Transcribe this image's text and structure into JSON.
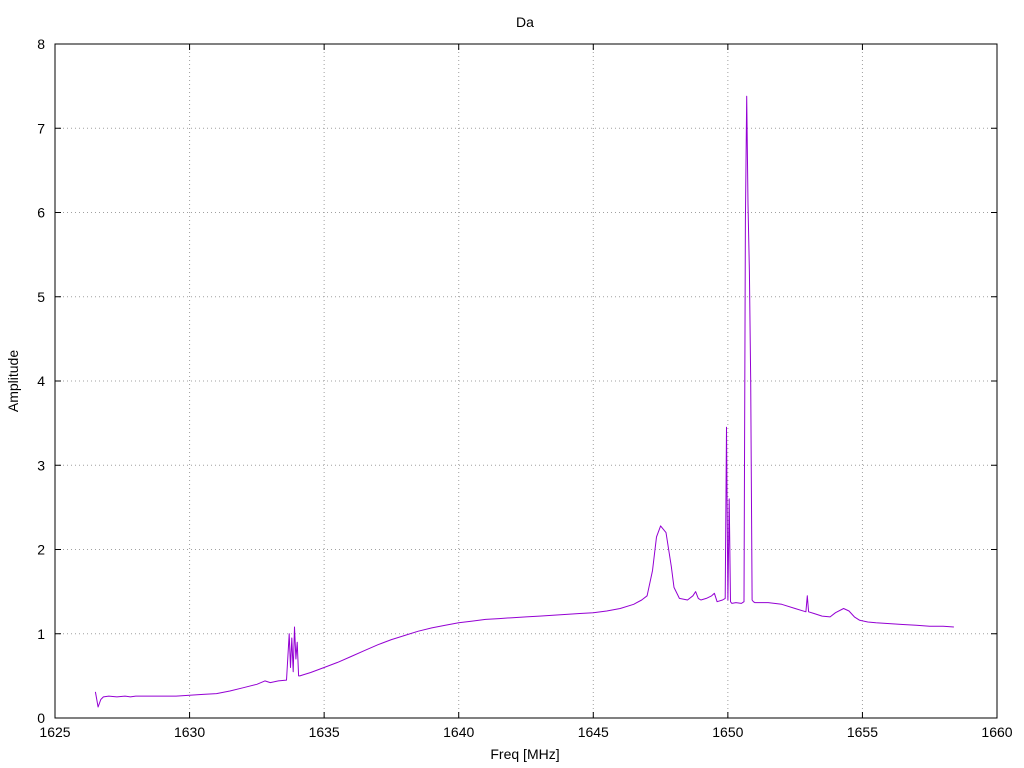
{
  "chart_data": {
    "type": "line",
    "title": "Da",
    "xlabel": "Freq [MHz]",
    "ylabel": "Amplitude",
    "xlim": [
      1625,
      1660
    ],
    "ylim": [
      0,
      8
    ],
    "xticks": [
      1625,
      1630,
      1635,
      1640,
      1645,
      1650,
      1655,
      1660
    ],
    "yticks": [
      0,
      1,
      2,
      3,
      4,
      5,
      6,
      7,
      8
    ],
    "grid": true,
    "legend": "none",
    "series": [
      {
        "color": "#9400d3",
        "x": [
          1626.5,
          1626.6,
          1626.7,
          1626.8,
          1627.0,
          1627.3,
          1627.6,
          1627.8,
          1628.0,
          1628.5,
          1629.0,
          1629.5,
          1630.0,
          1630.5,
          1631.0,
          1631.5,
          1632.0,
          1632.5,
          1632.8,
          1633.0,
          1633.3,
          1633.6,
          1633.7,
          1633.75,
          1633.8,
          1633.85,
          1633.9,
          1633.95,
          1634.0,
          1634.05,
          1634.1,
          1634.2,
          1634.5,
          1635.0,
          1635.5,
          1636.0,
          1636.5,
          1637.0,
          1637.5,
          1638.0,
          1638.5,
          1639.0,
          1639.5,
          1640.0,
          1640.5,
          1641.0,
          1641.5,
          1642.0,
          1642.5,
          1643.0,
          1643.5,
          1644.0,
          1644.5,
          1645.0,
          1645.5,
          1646.0,
          1646.5,
          1646.8,
          1647.0,
          1647.2,
          1647.35,
          1647.5,
          1647.7,
          1647.9,
          1648.0,
          1648.2,
          1648.5,
          1648.7,
          1648.8,
          1648.9,
          1649.0,
          1649.2,
          1649.4,
          1649.5,
          1649.6,
          1649.8,
          1649.9,
          1649.95,
          1650.0,
          1650.05,
          1650.1,
          1650.15,
          1650.3,
          1650.5,
          1650.6,
          1650.65,
          1650.7,
          1650.75,
          1650.8,
          1650.85,
          1650.9,
          1650.95,
          1651.0,
          1651.5,
          1652.0,
          1652.5,
          1652.9,
          1652.95,
          1653.0,
          1653.2,
          1653.5,
          1653.8,
          1654.0,
          1654.3,
          1654.5,
          1654.7,
          1654.9,
          1655.2,
          1655.5,
          1656.0,
          1656.5,
          1657.0,
          1657.5,
          1658.0,
          1658.4
        ],
        "y": [
          0.31,
          0.13,
          0.22,
          0.25,
          0.26,
          0.25,
          0.26,
          0.25,
          0.26,
          0.26,
          0.26,
          0.26,
          0.27,
          0.28,
          0.29,
          0.32,
          0.36,
          0.4,
          0.44,
          0.42,
          0.44,
          0.45,
          1.0,
          0.6,
          0.95,
          0.55,
          1.08,
          0.7,
          0.9,
          0.5,
          0.5,
          0.51,
          0.54,
          0.6,
          0.66,
          0.73,
          0.8,
          0.87,
          0.93,
          0.98,
          1.03,
          1.07,
          1.1,
          1.13,
          1.15,
          1.17,
          1.18,
          1.19,
          1.2,
          1.21,
          1.22,
          1.23,
          1.24,
          1.25,
          1.27,
          1.3,
          1.35,
          1.4,
          1.45,
          1.75,
          2.15,
          2.28,
          2.2,
          1.8,
          1.55,
          1.42,
          1.4,
          1.45,
          1.5,
          1.42,
          1.4,
          1.42,
          1.45,
          1.48,
          1.38,
          1.4,
          1.42,
          3.45,
          1.4,
          2.6,
          1.38,
          1.36,
          1.37,
          1.36,
          1.38,
          5.9,
          7.38,
          6.1,
          5.3,
          4.0,
          1.4,
          1.38,
          1.37,
          1.37,
          1.35,
          1.3,
          1.26,
          1.45,
          1.26,
          1.24,
          1.21,
          1.2,
          1.25,
          1.3,
          1.27,
          1.2,
          1.16,
          1.14,
          1.13,
          1.12,
          1.11,
          1.1,
          1.09,
          1.09,
          1.08
        ]
      }
    ]
  }
}
